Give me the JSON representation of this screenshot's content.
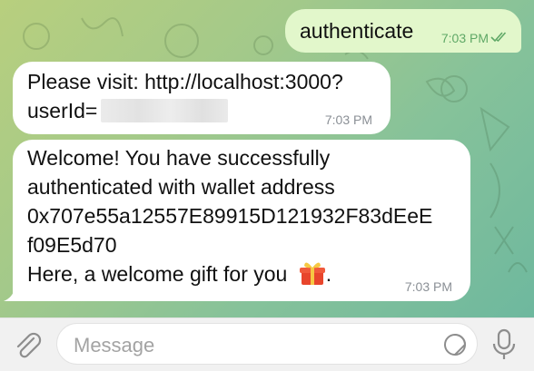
{
  "chat": {
    "messages": [
      {
        "direction": "outgoing",
        "text": "authenticate",
        "time": "7:03 PM",
        "status": "read"
      },
      {
        "direction": "incoming",
        "line1": "Please visit: http://localhost:3000?",
        "line2": "userId=",
        "redacted": true,
        "time": "7:03 PM"
      },
      {
        "direction": "incoming",
        "lines": [
          "Welcome! You have successfully",
          "authenticated with wallet address",
          "0x707e55a12557E89915D121932F83dEeE",
          "f09E5d70",
          "Here, a welcome gift for you"
        ],
        "after_emoji": ".",
        "emoji": "gift-icon",
        "time": "7:03 PM"
      }
    ]
  },
  "composer": {
    "placeholder": "Message",
    "attach_icon": "paperclip-icon",
    "sticker_icon": "sticker-icon",
    "mic_icon": "microphone-icon"
  },
  "colors": {
    "outgoing_bubble": "#e2f7cb",
    "incoming_bubble": "#ffffff",
    "read_ticks": "#5fa866"
  }
}
